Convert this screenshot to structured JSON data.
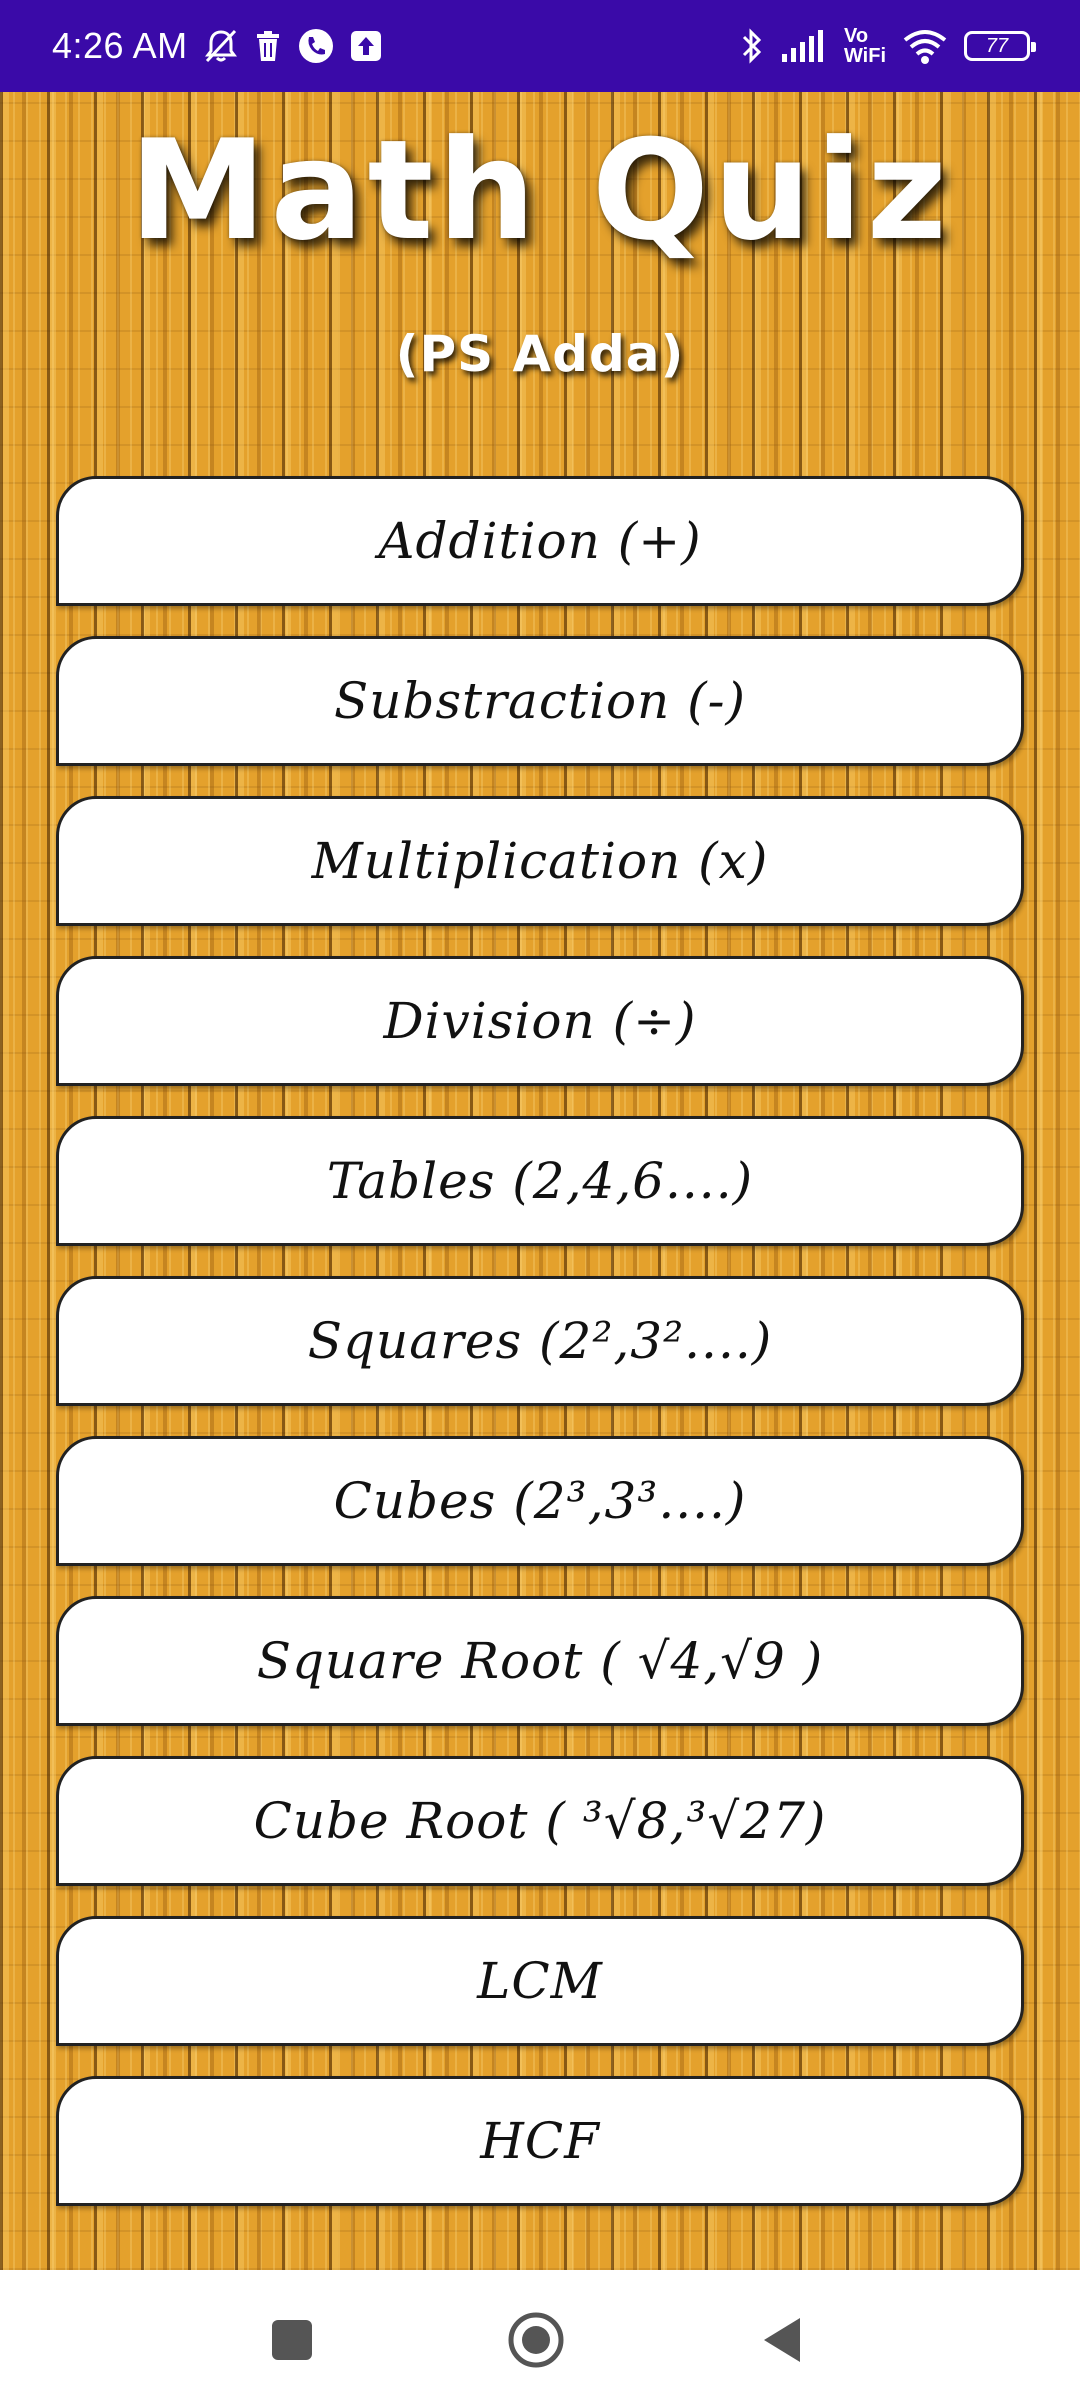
{
  "status_bar": {
    "time": "4:26 AM",
    "vowifi_top": "Vo",
    "vowifi_bottom": "WiFi",
    "battery": "77"
  },
  "app": {
    "title": "Math Quiz",
    "subtitle": "(PS Adda)"
  },
  "menu": {
    "items": [
      {
        "label": "Addition (+)"
      },
      {
        "label": "Substraction (-)"
      },
      {
        "label": "Multiplication (x)"
      },
      {
        "label": "Division (÷)"
      },
      {
        "label": "Tables (2,4,6....)"
      },
      {
        "label": "Squares (2²,3²....)"
      },
      {
        "label": "Cubes (2³,3³....)"
      },
      {
        "label": "Square Root ( √4,√9 )"
      },
      {
        "label": "Cube Root ( ³√8,³√27)"
      },
      {
        "label": "LCM"
      },
      {
        "label": "HCF"
      }
    ]
  },
  "colors": {
    "status_bar": "#3a0aa8",
    "wood": "#e4a12c",
    "button_bg": "#ffffff",
    "nav_icons": "#555555"
  },
  "icons": {
    "status_left": [
      "mute-bell-icon",
      "trash-icon",
      "phone-icon",
      "upload-icon"
    ],
    "status_right": [
      "bluetooth-icon",
      "signal-icon",
      "vowifi-icon",
      "wifi-icon",
      "battery-icon"
    ],
    "nav": [
      "recent-apps-icon",
      "home-icon",
      "back-icon"
    ]
  }
}
